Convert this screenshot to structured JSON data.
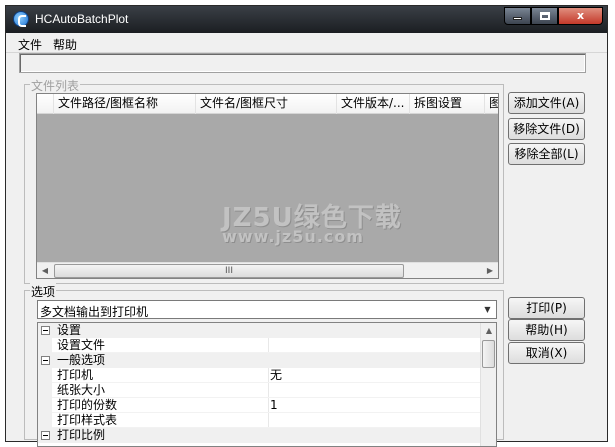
{
  "window": {
    "title": "HCAutoBatchPlot",
    "minimize_glyph": "minimize-icon",
    "maximize_glyph": "maximize-icon",
    "close_label": "x"
  },
  "menu": {
    "file": "文件",
    "help": "帮助"
  },
  "path_field": {
    "value": ""
  },
  "file_group": {
    "legend": "文件列表",
    "columns": [
      "文件路径/图框名称",
      "文件名/图框尺寸",
      "文件版本/...",
      "拆图设置",
      "图"
    ],
    "scrollbar_thumb_grip": "III",
    "buttons": {
      "add": "添加文件(A)",
      "remove": "移除文件(D)",
      "remove_all": "移除全部(L)"
    }
  },
  "options_group": {
    "legend": "选项",
    "mode_select": {
      "value": "多文档输出到打印机"
    },
    "properties": [
      {
        "kind": "category",
        "label": "设置",
        "value": ""
      },
      {
        "kind": "item",
        "label": "设置文件",
        "value": ""
      },
      {
        "kind": "category",
        "label": "一般选项",
        "value": ""
      },
      {
        "kind": "item",
        "label": "打印机",
        "value": "无"
      },
      {
        "kind": "item",
        "label": "纸张大小",
        "value": ""
      },
      {
        "kind": "item",
        "label": "打印的份数",
        "value": "1"
      },
      {
        "kind": "item",
        "label": "打印样式表",
        "value": ""
      },
      {
        "kind": "category",
        "label": "打印比例",
        "value": ""
      }
    ],
    "buttons": {
      "print": "打印(P)",
      "help": "帮助(H)",
      "cancel": "取消(X)"
    }
  },
  "watermark": {
    "main": "JZ5U绿色下载",
    "sub": "www.jz5u.com"
  },
  "colors": {
    "list_background": "#a9a9a9",
    "titlebar": "#1b1e22",
    "close_button": "#c4392a"
  }
}
